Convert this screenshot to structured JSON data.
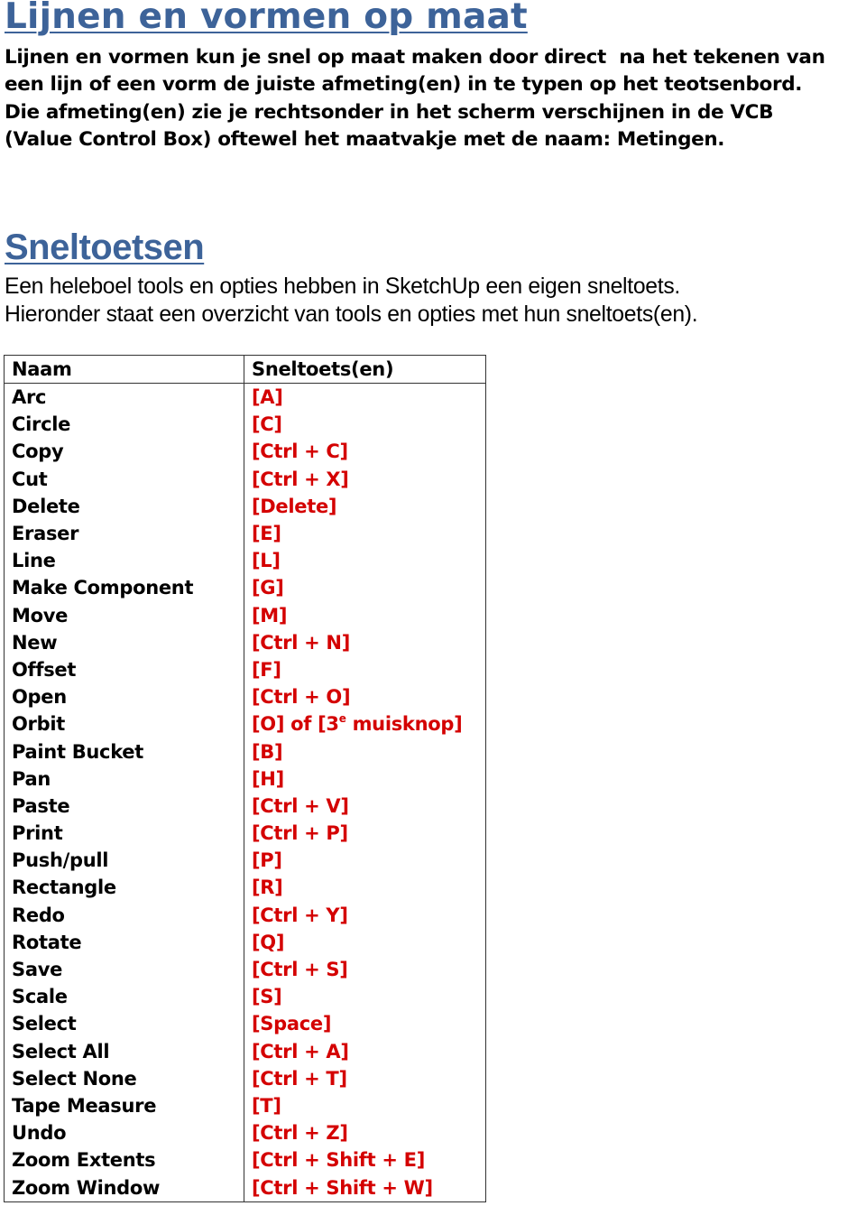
{
  "section1": {
    "title": "Lijnen en vormen op maat",
    "intro_lines": [
      "Lijnen en vormen kun je snel op maat maken door direct  na het tekenen van",
      "een lijn of een vorm de juiste afmeting(en) in te typen op het teotsenbord.",
      "Die afmeting(en) zie je rechtsonder in het scherm verschijnen in de VCB",
      "(Value Control Box) oftewel het maatvakje met de naam: Metingen."
    ]
  },
  "section2": {
    "title": "Sneltoetsen",
    "intro_lines": [
      "Een heleboel tools en opties hebben in SketchUp een eigen sneltoets.",
      "Hieronder staat een overzicht van tools en opties met hun sneltoets(en)."
    ]
  },
  "colors": {
    "heading": "#3d6399",
    "shortcut": "#d40000",
    "text": "#000000"
  },
  "table": {
    "headers": {
      "name": "Naam",
      "shortcut": "Sneltoets(en)"
    },
    "orbit_special": {
      "pre": "[O] of [3",
      "sup": "e",
      "post": " muisknop]"
    },
    "rows": [
      {
        "name": "Arc",
        "shortcut": "[A]"
      },
      {
        "name": "Circle",
        "shortcut": "[C]"
      },
      {
        "name": "Copy",
        "shortcut": "[Ctrl + C]"
      },
      {
        "name": "Cut",
        "shortcut": "[Ctrl + X]"
      },
      {
        "name": "Delete",
        "shortcut": "[Delete]"
      },
      {
        "name": "Eraser",
        "shortcut": "[E]"
      },
      {
        "name": "Line",
        "shortcut": "[L]"
      },
      {
        "name": "Make Component",
        "shortcut": "[G]"
      },
      {
        "name": "Move",
        "shortcut": "[M]"
      },
      {
        "name": "New",
        "shortcut": "[Ctrl + N]"
      },
      {
        "name": "Offset",
        "shortcut": "[F]"
      },
      {
        "name": "Open",
        "shortcut": "[Ctrl + O]"
      },
      {
        "name": "Orbit",
        "shortcut": "[O] of [3e muisknop]"
      },
      {
        "name": "Paint Bucket",
        "shortcut": "[B]"
      },
      {
        "name": "Pan",
        "shortcut": "[H]"
      },
      {
        "name": "Paste",
        "shortcut": "[Ctrl + V]"
      },
      {
        "name": "Print",
        "shortcut": "[Ctrl + P]"
      },
      {
        "name": "Push/pull",
        "shortcut": "[P]"
      },
      {
        "name": "Rectangle",
        "shortcut": "[R]"
      },
      {
        "name": "Redo",
        "shortcut": "[Ctrl + Y]"
      },
      {
        "name": "Rotate",
        "shortcut": "[Q]"
      },
      {
        "name": "Save",
        "shortcut": "[Ctrl + S]"
      },
      {
        "name": "Scale",
        "shortcut": "[S]"
      },
      {
        "name": "Select",
        "shortcut": "[Space]"
      },
      {
        "name": "Select All",
        "shortcut": "[Ctrl + A]"
      },
      {
        "name": "Select None",
        "shortcut": "[Ctrl + T]"
      },
      {
        "name": "Tape Measure",
        "shortcut": "[T]"
      },
      {
        "name": "Undo",
        "shortcut": "[Ctrl + Z]"
      },
      {
        "name": "Zoom Extents",
        "shortcut": "[Ctrl + Shift + E]"
      },
      {
        "name": "Zoom Window",
        "shortcut": "[Ctrl + Shift + W]"
      }
    ]
  }
}
